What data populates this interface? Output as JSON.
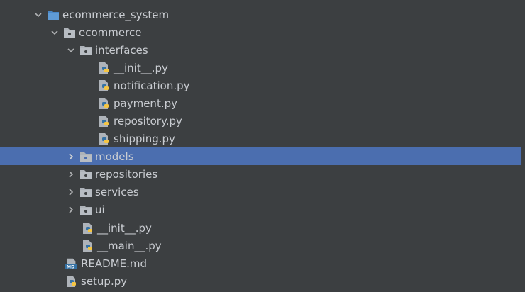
{
  "tree": {
    "root": {
      "label": "ecommerce_system",
      "icon": "folder-icon",
      "expanded": true
    },
    "ecommerce": {
      "label": "ecommerce",
      "icon": "package-icon",
      "expanded": true
    },
    "interfaces": {
      "label": "interfaces",
      "icon": "package-icon",
      "expanded": true
    },
    "interface_files": [
      {
        "label": "__init__.py",
        "icon": "python-file-icon"
      },
      {
        "label": "notification.py",
        "icon": "python-file-icon"
      },
      {
        "label": "payment.py",
        "icon": "python-file-icon"
      },
      {
        "label": "repository.py",
        "icon": "python-file-icon"
      },
      {
        "label": "shipping.py",
        "icon": "python-file-icon"
      }
    ],
    "collapsed_packages": [
      {
        "label": "models",
        "icon": "package-icon",
        "selected": true
      },
      {
        "label": "repositories",
        "icon": "package-icon",
        "selected": false
      },
      {
        "label": "services",
        "icon": "package-icon",
        "selected": false
      },
      {
        "label": "ui",
        "icon": "package-icon",
        "selected": false
      }
    ],
    "ecommerce_files": [
      {
        "label": "__init__.py",
        "icon": "python-file-icon"
      },
      {
        "label": "__main__.py",
        "icon": "python-file-icon"
      }
    ],
    "root_files": [
      {
        "label": "README.md",
        "icon": "markdown-file-icon"
      },
      {
        "label": "setup.py",
        "icon": "python-file-icon"
      }
    ]
  },
  "colors": {
    "background": "#3c3f41",
    "selection": "#4b6eaf",
    "text": "#c9ccd1",
    "folder_blue": "#4a88c7",
    "package_gray": "#aeb3b9"
  }
}
